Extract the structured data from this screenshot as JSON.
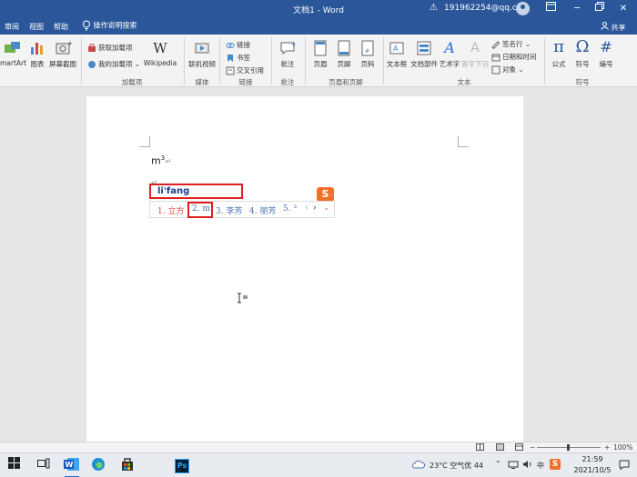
{
  "window": {
    "title": "文档1 - Word",
    "account": "191962254@qq.com",
    "controls": [
      "─",
      "□",
      "✕"
    ]
  },
  "tabs": [
    "审阅",
    "视图",
    "帮助"
  ],
  "tellme": "操作说明搜索",
  "share": "共享",
  "ribbon": {
    "smartart": "martArt",
    "chart": "图表",
    "screenshot": "屏幕截图",
    "get_addins": "获取加载项",
    "my_addins": "我的加载项",
    "wikipedia": "Wikipedia",
    "online_video": "联机视频",
    "link": "链接",
    "bookmark": "书签",
    "cross_ref": "交叉引用",
    "comment": "批注",
    "header": "页眉",
    "footer": "页脚",
    "page_number": "页码",
    "text_box": "文本框",
    "quick_parts": "文档部件",
    "wordart": "艺术字",
    "drop_cap": "首字下沉",
    "signature": "签名行",
    "datetime": "日期和时间",
    "object": "对象",
    "equation": "公式",
    "symbol": "符号",
    "numbering": "编号",
    "groups": {
      "addins": "加载项",
      "media": "媒体",
      "links": "链接",
      "comments": "批注",
      "header_footer": "页眉和页脚",
      "text": "文本",
      "symbols": "符号"
    }
  },
  "document": {
    "line1_base": "m",
    "line1_sup": "3",
    "pilcrow": "↵"
  },
  "ime": {
    "composition": "li'fang",
    "candidates": [
      "1. 立方",
      "2. m³",
      "3. 李芳",
      "4. 丽芳",
      "5. ³"
    ],
    "logo": "S"
  },
  "statusbar": {
    "zoom": "100%"
  },
  "taskbar": {
    "weather": "23°C 空气优 44",
    "ime_lang": "中",
    "time": "21:59",
    "date": "2021/10/5",
    "ps_label": "Ps"
  }
}
